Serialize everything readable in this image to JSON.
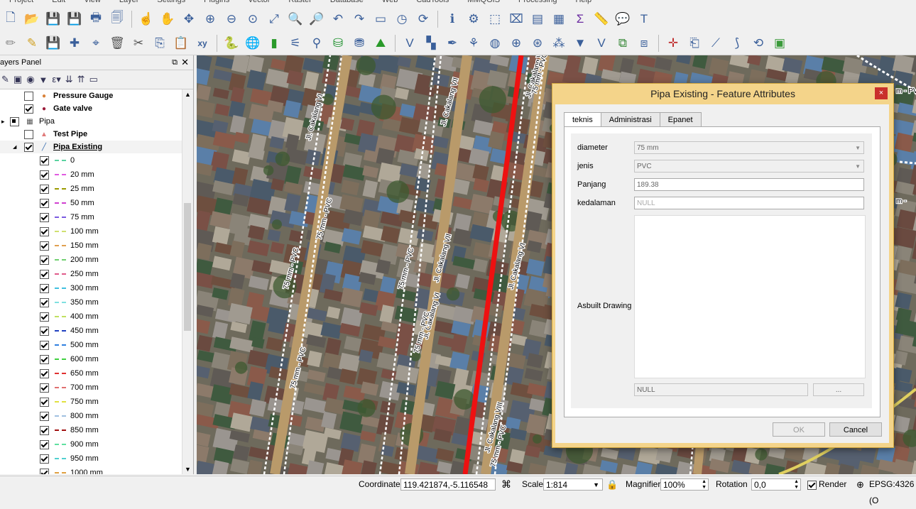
{
  "menu": [
    "Project",
    "Edit",
    "View",
    "Layer",
    "Settings",
    "Plugins",
    "Vector",
    "Raster",
    "Database",
    "Web",
    "CadTools",
    "MMQGIS",
    "Processing",
    "Help"
  ],
  "icons": {
    "toolbar1": [
      "new-project-icon",
      "open-project-icon",
      "save-project-icon",
      "save-as-icon",
      "new-print-layout-icon",
      "layout-manager-icon",
      "touch-icon",
      "pan-icon",
      "pan-to-selection-icon",
      "zoom-in-icon",
      "zoom-out-icon",
      "zoom-native-icon",
      "zoom-full-icon",
      "zoom-to-selection-icon",
      "zoom-to-layer-icon",
      "zoom-last-icon",
      "zoom-next-icon",
      "new-map-view-icon",
      "temporal-icon",
      "refresh-icon",
      "identify-icon",
      "action-icon",
      "select-features-icon",
      "deselect-icon",
      "open-attribute-table-icon",
      "field-calculator-icon",
      "statistics-icon",
      "measure-icon",
      "annotation-icon",
      "label-icon"
    ],
    "toolbar2": [
      "digitize-icon",
      "edit-pencil-icon",
      "save-edits-icon",
      "add-feature-icon",
      "vertex-tool-icon",
      "delete-selected-icon",
      "cut-features-icon",
      "copy-features-icon",
      "paste-features-icon",
      "xy-icon",
      "python-console-icon",
      "globe-icon",
      "layer-green-icon",
      "pipette-icon",
      "gps-icon",
      "sql-icon",
      "db-manager-icon",
      "terrain-icon",
      "add-vertex-icon",
      "checker-icon",
      "pen-icon",
      "plugin-icon",
      "web-icon",
      "globe-add-icon",
      "settings-globe-icon",
      "node-icon",
      "advanced-digitize-icon",
      "snapping-icon",
      "merge-icon",
      "split-icon",
      "crosshair-icon",
      "clipboard-icon",
      "split-parts-icon",
      "reshape-icon",
      "rotate-icon",
      "layer-add-icon"
    ]
  },
  "layers_panel": {
    "title": "ayers Panel",
    "rows": [
      {
        "label": "Pressure Gauge",
        "checked": false,
        "bold": true,
        "sym": "●",
        "color": "#d9823a",
        "indent": 1
      },
      {
        "label": "Gate valve",
        "checked": true,
        "bold": true,
        "sym": "●",
        "color": "#9b1b3a",
        "indent": 1
      },
      {
        "label": "Pipa",
        "checked": true,
        "bold": false,
        "sym": "▦",
        "color": "#555",
        "indent": 0,
        "group": true
      },
      {
        "label": "Test Pipe",
        "checked": false,
        "bold": true,
        "sym": "▲",
        "color": "#e07a7a",
        "indent": 1
      },
      {
        "label": "Pipa Existing",
        "checked": true,
        "bold": true,
        "sym": "╱",
        "color": "#3a6fb0",
        "indent": 1,
        "underline": true
      }
    ],
    "legend": [
      {
        "label": "0",
        "color": "#5bd3a0"
      },
      {
        "label": "20 mm",
        "color": "#e05be0"
      },
      {
        "label": "25 mm",
        "color": "#9a9a00"
      },
      {
        "label": "50 mm",
        "color": "#d040d0"
      },
      {
        "label": "75 mm",
        "color": "#7a5be0"
      },
      {
        "label": "100 mm",
        "color": "#d0e070"
      },
      {
        "label": "150 mm",
        "color": "#e0a050"
      },
      {
        "label": "200 mm",
        "color": "#70d070"
      },
      {
        "label": "250 mm",
        "color": "#e05b8a"
      },
      {
        "label": "300 mm",
        "color": "#40c0e0"
      },
      {
        "label": "350 mm",
        "color": "#80e0e0"
      },
      {
        "label": "400 mm",
        "color": "#c0e060"
      },
      {
        "label": "450 mm",
        "color": "#2040c0"
      },
      {
        "label": "500 mm",
        "color": "#3080e0"
      },
      {
        "label": "600 mm",
        "color": "#40d040"
      },
      {
        "label": "650 mm",
        "color": "#e03030"
      },
      {
        "label": "700 mm",
        "color": "#e07070"
      },
      {
        "label": "750 mm",
        "color": "#e0e040"
      },
      {
        "label": "800 mm",
        "color": "#a0c0e0"
      },
      {
        "label": "850 mm",
        "color": "#a01010"
      },
      {
        "label": "900 mm",
        "color": "#60e0a0"
      },
      {
        "label": "950 mm",
        "color": "#50d0d0"
      },
      {
        "label": "1000 mm",
        "color": "#e0a040"
      }
    ]
  },
  "map": {
    "road_labels": [
      "75 mm - PVC",
      "Jl. Cakalang VI",
      "Jl. Cakalang VII",
      "Jl. Cakalang VIII",
      "Jl. Cakalang VII",
      "75 mm - PVC",
      "75 mm - PVC",
      "Jl. Cakalang VI",
      "75 mm - PVC",
      "75 mm - PVC",
      "75 mm - PVC",
      "75 mm - PVC",
      "Jl. Cakalang VIII",
      "Jl. Cakalang VI",
      "m - PVC",
      "m -"
    ]
  },
  "dialog": {
    "title": "Pipa Existing  - Feature Attributes",
    "close": "×",
    "tabs": [
      "teknis",
      "Administrasi",
      "Epanet"
    ],
    "fields": {
      "diameter": {
        "label": "diameter",
        "value": "75 mm"
      },
      "jenis": {
        "label": "jenis",
        "value": "PVC"
      },
      "panjang": {
        "label": "Panjang",
        "value": "189.38"
      },
      "kedalaman": {
        "label": "kedalaman",
        "value": "NULL"
      },
      "asbuilt": {
        "label": "Asbuilt Drawing",
        "value": "NULL",
        "browse": "..."
      }
    },
    "ok": "OK",
    "cancel": "Cancel"
  },
  "status": {
    "coordinate_label": "Coordinate",
    "coordinate_value": "119.421874,-5.116548",
    "scale_label": "Scale",
    "scale_value": "1:814",
    "magnifier_label": "Magnifier",
    "magnifier_value": "100%",
    "rotation_label": "Rotation",
    "rotation_value": "0,0",
    "render_label": "Render",
    "crs": "EPSG:4326 (O"
  }
}
